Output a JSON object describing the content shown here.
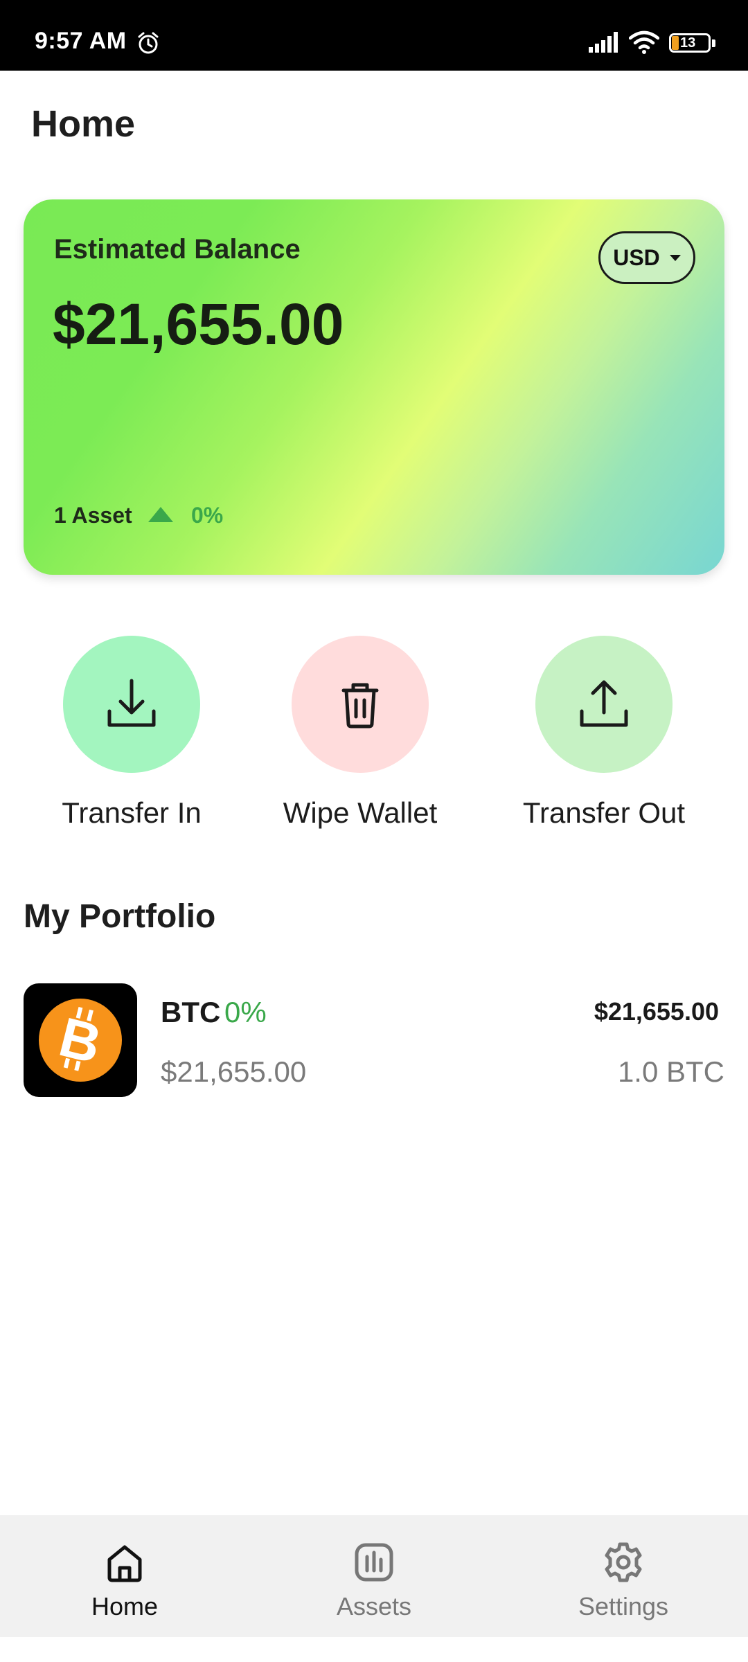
{
  "status_bar": {
    "time": "9:57 AM",
    "battery": "13",
    "icons": [
      "alarm-icon",
      "signal-icon",
      "wifi-icon",
      "battery-icon"
    ]
  },
  "header": {
    "title": "Home"
  },
  "balance_card": {
    "label": "Estimated Balance",
    "amount": "$21,655.00",
    "currency": "USD",
    "asset_count": "1 Asset",
    "change": "0%",
    "colors": {
      "gradient_start": "#79ea55",
      "gradient_mid": "#e2fd76",
      "gradient_end": "#78d6d2",
      "positive": "#3aa84a"
    }
  },
  "actions": [
    {
      "label": "Transfer In",
      "icon": "download-icon",
      "color": "#a3f5bf"
    },
    {
      "label": "Wipe Wallet",
      "icon": "trash-icon",
      "color": "#ffdcdc"
    },
    {
      "label": "Transfer Out",
      "icon": "upload-icon",
      "color": "#c6f2c4"
    }
  ],
  "portfolio": {
    "title": "My Portfolio",
    "items": [
      {
        "symbol": "BTC",
        "change": "0%",
        "price": "$21,655.00",
        "value": "$21,655.00",
        "quantity": "1.0 BTC",
        "icon": "bitcoin-icon",
        "icon_color": "#f7931a"
      }
    ]
  },
  "bottom_nav": {
    "items": [
      {
        "label": "Home",
        "icon": "home-icon",
        "active": true
      },
      {
        "label": "Assets",
        "icon": "chart-icon",
        "active": false
      },
      {
        "label": "Settings",
        "icon": "gear-icon",
        "active": false
      }
    ]
  }
}
